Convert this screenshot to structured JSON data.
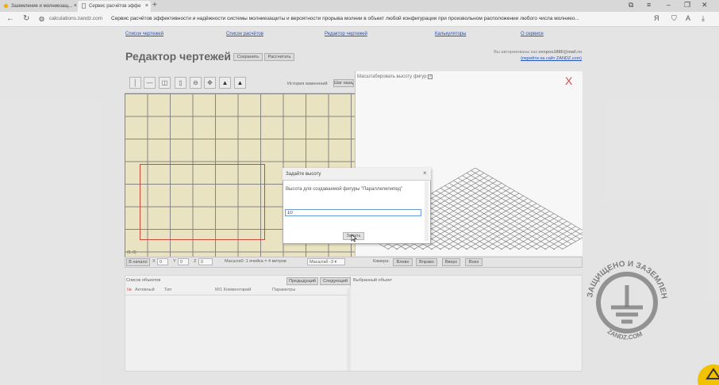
{
  "browser": {
    "tabs": [
      {
        "title": "Заземление и молниезащ..."
      },
      {
        "title": "Сервис расчётов эффе"
      }
    ],
    "url": "calculations.zandz.com",
    "page_title": "Сервис расчётов эффективности и надёжности системы молниезащиты и вероятности прорыва молнии в объект любой конфигурации при произвольном расположении любого числа молниео..."
  },
  "nav": {
    "links": [
      "Список чертежей",
      "Список расчётов",
      "Редактор чертежей",
      "Калькуляторы",
      "О сервисе"
    ]
  },
  "header": {
    "title": "Редактор чертежей",
    "save_label": "Сохранить",
    "calc_label": "Рассчитать",
    "auth_prefix": "Вы авторизованы как",
    "auth_user": "zenpos1886@mail.ru",
    "auth_link": "(перейти на сайт ZANDZ.com)"
  },
  "editor": {
    "history_label": "История изменений",
    "history_btn": "Шаг назад",
    "scale_heights_label": "Масштабировать высоту фигур",
    "scale_heights_checked": true,
    "close_glyph": "X"
  },
  "statusbar": {
    "start_btn": "В начало",
    "x_label": "X",
    "x_value": "0",
    "y_label": "Y",
    "y_value": "0",
    "z_label": "Z",
    "z_value": "0",
    "scale_text": "Масштаб: 1 ячейка = 4 метров",
    "scale_select": "Масштаб -3",
    "camera_label": "Камера:",
    "cam_buttons": [
      "Влево",
      "Вправо",
      "Вверх",
      "Вниз"
    ],
    "grid_corner_label": "(0, 0)"
  },
  "objects": {
    "title": "Список объектов",
    "prev_btn": "Предыдущий",
    "next_btn": "Следующий",
    "selected_label": "Выбранный объект",
    "columns": [
      "№",
      "Активный",
      "Тип",
      "М/1 Комментарий",
      "Параметры"
    ]
  },
  "dialog": {
    "title": "Задайте высоту",
    "close_glyph": "×",
    "text": "Высота для создаваемой фигуры \"Параллелепипед\"",
    "input_value": "10",
    "ok_label": "Задать"
  },
  "watermark": {
    "text": "ЗАЩИЩЕНО И ЗАЗЕМЛЕНО",
    "site": "ZANDZ.COM"
  },
  "colors": {
    "grid_bg": "#f1ebc8",
    "selection": "#d24c3c",
    "link": "#2a56b8"
  }
}
